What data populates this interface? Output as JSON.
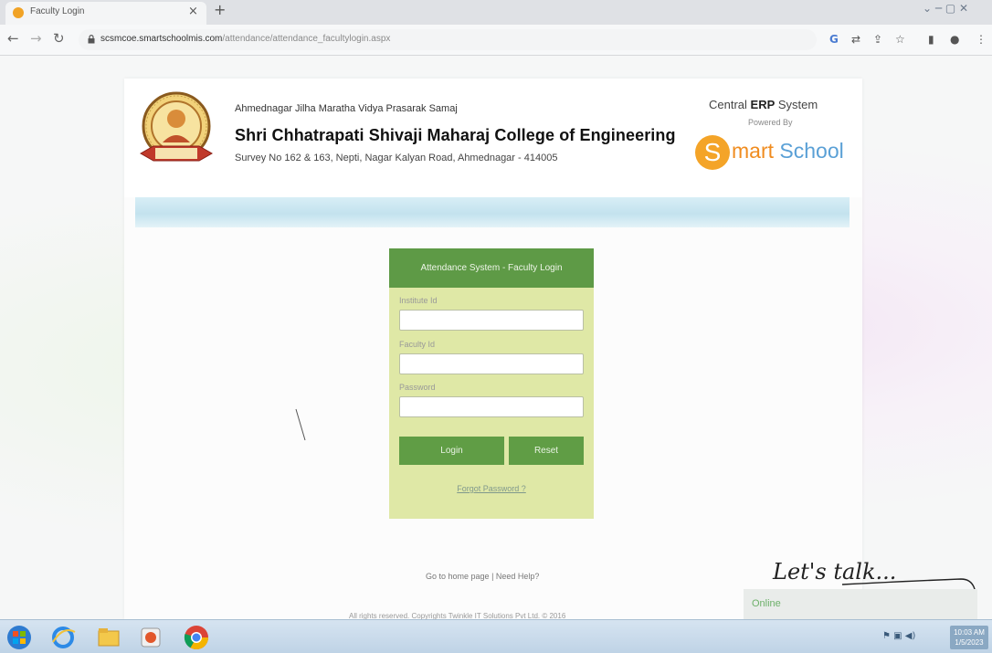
{
  "browser": {
    "tab_title": "Faculty Login",
    "tab_close": "×",
    "new_tab": "+",
    "url_host": "scsmcoe.smartschoolmis.com",
    "url_path": "/attendance/attendance_facultylogin.aspx",
    "window_controls": "⌄  ─  ▢  ✕"
  },
  "header": {
    "org_subtitle": "Ahmednagar Jilha Maratha Vidya Prasarak Samaj",
    "college_name": "Shri Chhatrapati Shivaji Maharaj College of Engineering",
    "address": "Survey No 162 & 163, Nepti, Nagar Kalyan Road, Ahmednagar - 414005",
    "erp_prefix": "Central ",
    "erp_bold": "ERP",
    "erp_suffix": " System",
    "powered_by": "Powered By",
    "brand_s": "S",
    "brand_mart": "mart",
    "brand_school": "School",
    "colors": {
      "ribbon": "#c3e2ee",
      "brand_orange": "#f4a428",
      "brand_blue": "#5aa0d6"
    }
  },
  "login": {
    "panel_title": "Attendance System - Faculty Login",
    "institute_label": "Institute Id",
    "institute_value": "",
    "faculty_label": "Faculty Id",
    "faculty_value": "",
    "password_label": "Password",
    "password_value": "",
    "login_button": "Login",
    "reset_button": "Reset",
    "forgot_link": "Forgot Password ?",
    "colors": {
      "header": "#5e9a46",
      "panel": "#dfe8a6",
      "button": "#609d45"
    }
  },
  "footer": {
    "home_link": "Go to home page",
    "separator": " | ",
    "help_link": "Need Help?",
    "copyright": "All rights reserved. Copyrights Twinkle IT Solutions Pvt Ltd. © 2016"
  },
  "chat": {
    "title": "Let's talk...",
    "status": "Online"
  },
  "taskbar": {
    "time": "10:03 AM",
    "date": "1/5/2023"
  }
}
